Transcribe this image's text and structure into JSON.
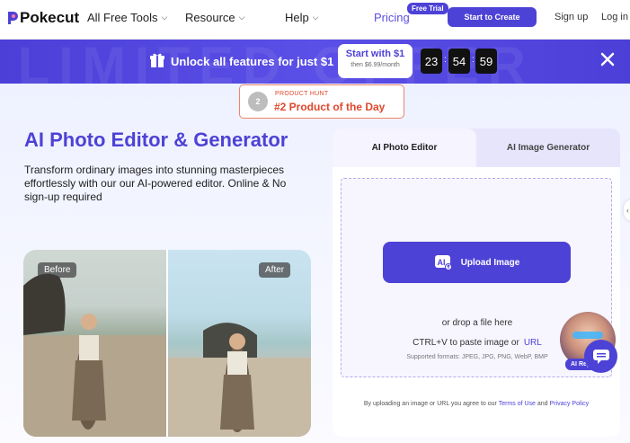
{
  "header": {
    "logo": "Pokecut",
    "nav": [
      {
        "label": "All Free Tools",
        "icon": "chevron-down-icon"
      },
      {
        "label": "Resource",
        "icon": "chevron-down-icon"
      },
      {
        "label": "Help",
        "icon": "chevron-down-icon"
      }
    ],
    "pricing": "Pricing",
    "trial_badge": "Free Trial",
    "start_button": "Start to Create",
    "signup": "Sign up",
    "login": "Log in"
  },
  "banner": {
    "watermark": "LIMITED OFFER",
    "text": "Unlock all features for just $1",
    "cta_main": "Start with $1",
    "cta_sub": "then $6.99/month",
    "timer": {
      "hours": "23",
      "minutes": "54",
      "seconds": "59",
      "separator": ":"
    },
    "icons": [
      "gift-icon",
      "close-icon"
    ]
  },
  "product_hunt": {
    "label": "PRODUCT HUNT",
    "title": "#2 Product of the Day",
    "medal": "2"
  },
  "hero": {
    "title": "AI Photo Editor & Generator",
    "description": "Transform ordinary images into stunning masterpieces effortlessly with our our AI-powered editor. Online & No sign-up required"
  },
  "compare": {
    "before_label": "Before",
    "after_label": "After"
  },
  "panel": {
    "tabs": [
      {
        "label": "AI Photo Editor",
        "active": true
      },
      {
        "label": "AI Image Generator",
        "active": false
      }
    ],
    "upload_button": "Upload Image",
    "upload_icon": "ai-upload-icon",
    "drop_text": "or drop a file here",
    "paste_text": "CTRL+V to paste image or",
    "paste_link": "URL",
    "formats": "Supported formats: JPEG, JPG, PNG, WebP, BMP",
    "ai_replace": "AI Replace",
    "terms": {
      "prefix": "By uploading an image or URL you agree to our",
      "terms_link": "Terms of Use",
      "and": "and",
      "privacy_link": "Privacy Policy"
    }
  },
  "colors": {
    "accent": "#4d42d6",
    "product_hunt": "#e0472c"
  }
}
